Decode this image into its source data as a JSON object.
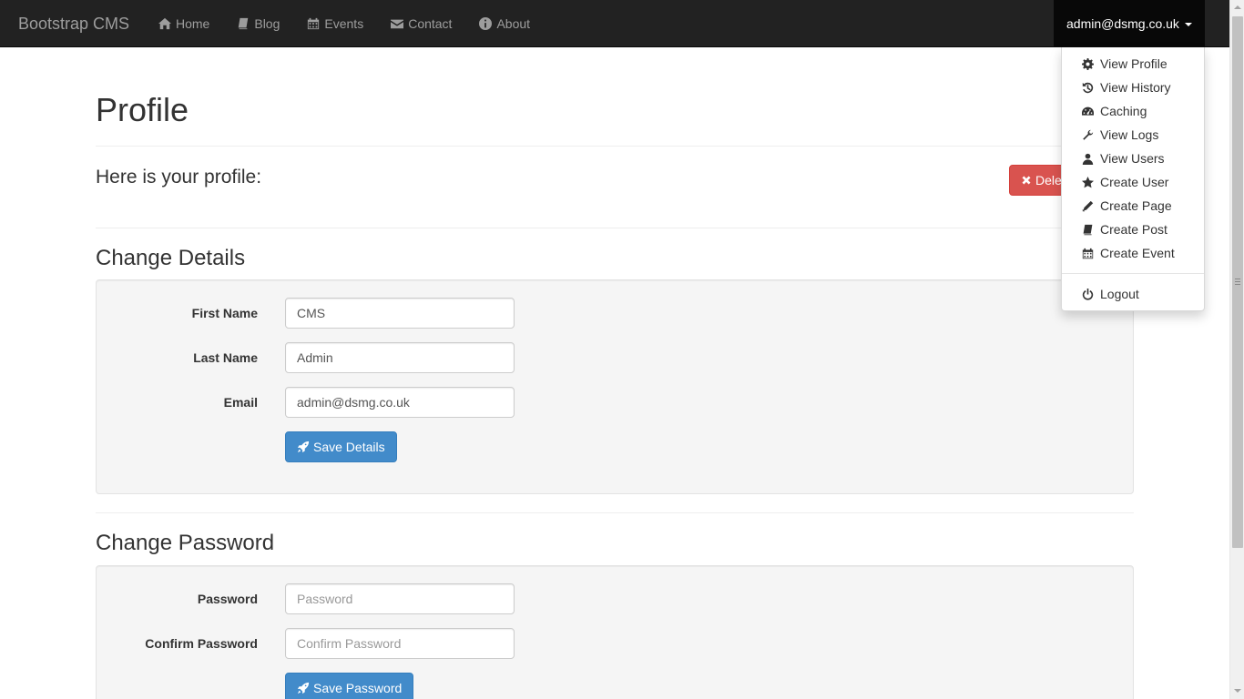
{
  "navbar": {
    "brand": "Bootstrap CMS",
    "links": [
      {
        "label": "Home",
        "icon": "home-icon"
      },
      {
        "label": "Blog",
        "icon": "book-icon"
      },
      {
        "label": "Events",
        "icon": "calendar-icon"
      },
      {
        "label": "Contact",
        "icon": "envelope-icon"
      },
      {
        "label": "About",
        "icon": "info-icon"
      }
    ],
    "user": "admin@dsmg.co.uk"
  },
  "dropdown": {
    "items": [
      {
        "label": "View Profile",
        "icon": "cog-icon"
      },
      {
        "label": "View History",
        "icon": "history-icon"
      },
      {
        "label": "Caching",
        "icon": "dashboard-icon"
      },
      {
        "label": "View Logs",
        "icon": "wrench-icon"
      },
      {
        "label": "View Users",
        "icon": "user-icon"
      },
      {
        "label": "Create User",
        "icon": "star-icon"
      },
      {
        "label": "Create Page",
        "icon": "pencil-icon"
      },
      {
        "label": "Create Post",
        "icon": "book-icon"
      },
      {
        "label": "Create Event",
        "icon": "calendar-icon"
      }
    ],
    "logout": {
      "label": "Logout",
      "icon": "power-icon"
    }
  },
  "page": {
    "title": "Profile",
    "lead": "Here is your profile:",
    "delete_label": "Dele"
  },
  "details": {
    "heading": "Change Details",
    "first_name_label": "First Name",
    "first_name_value": "CMS",
    "last_name_label": "Last Name",
    "last_name_value": "Admin",
    "email_label": "Email",
    "email_value": "admin@dsmg.co.uk",
    "save_label": "Save Details"
  },
  "password": {
    "heading": "Change Password",
    "password_label": "Password",
    "password_placeholder": "Password",
    "confirm_label": "Confirm Password",
    "confirm_placeholder": "Confirm Password",
    "save_label": "Save Password"
  },
  "colors": {
    "navbar": "#222222",
    "primary": "#428bca",
    "danger": "#d9534f"
  }
}
